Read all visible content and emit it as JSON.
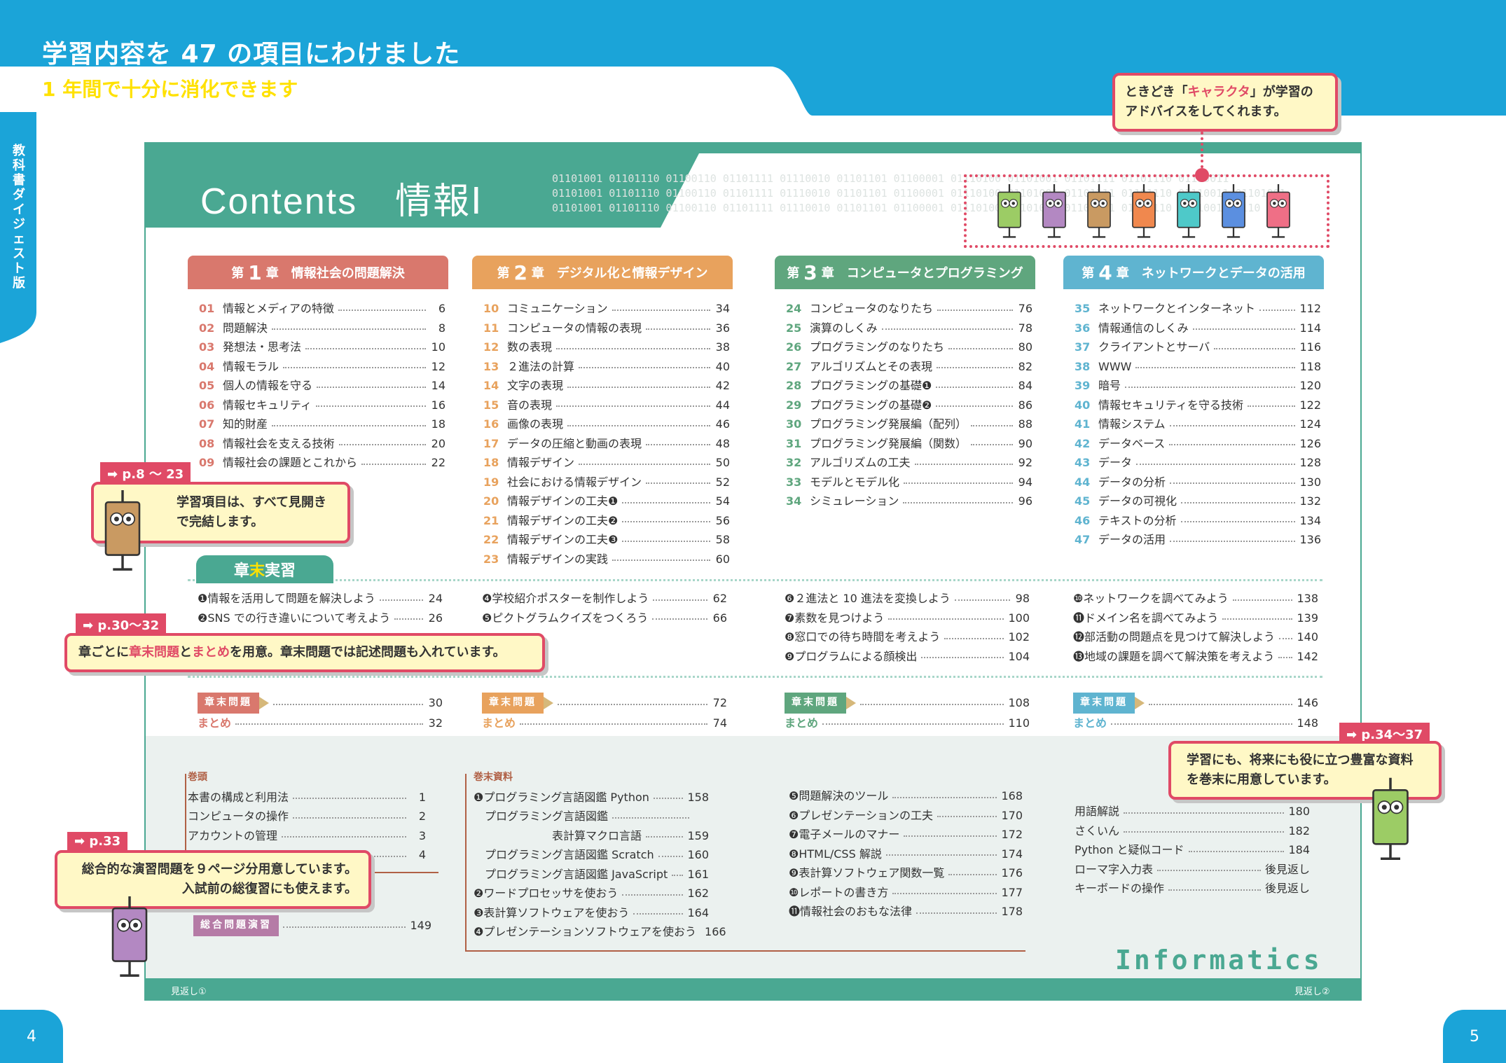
{
  "header": {
    "title": "学習内容を 47 の項目にわけました",
    "subtitle": "1 年間で十分に消化できます",
    "side_label": "教科書ダイジェスト版"
  },
  "pages": {
    "left": "4",
    "right": "5"
  },
  "panel": {
    "title": "Contents　情報Ⅰ",
    "binary": [
      "01101001 01101110 01100110 01101111 01110010 01101101 01100001 01110100 01101001 01101111 01101110 01110011",
      "01101001 01101110 01100110 01101111 01110010 01101101 01100001 01110100 01101001 01101111 01101110 01110011 01101001",
      "01101001 01101110 01100110 01101111 01110010 01101101 01100001 01110100 01101001 01101111 01101110 01110011 0110"
    ],
    "footer_left": "見返し①",
    "footer_right": "見返し②",
    "brand": "Informatics"
  },
  "colors": {
    "blue": "#1ba4d8",
    "green": "#4aa892",
    "ch1": "#d9786d",
    "ch2": "#e8a25d",
    "ch3": "#5fa67e",
    "ch4": "#5fb4d0",
    "accent": "#e04a66"
  },
  "chapters": [
    {
      "pre": "第",
      "num": "1",
      "post": "章　情報社会の問題解決",
      "items": [
        {
          "n": "01",
          "t": "情報とメディアの特徴",
          "p": "6"
        },
        {
          "n": "02",
          "t": "問題解決",
          "p": "8"
        },
        {
          "n": "03",
          "t": "発想法・思考法",
          "p": "10"
        },
        {
          "n": "04",
          "t": "情報モラル",
          "p": "12"
        },
        {
          "n": "05",
          "t": "個人の情報を守る",
          "p": "14"
        },
        {
          "n": "06",
          "t": "情報セキュリティ",
          "p": "16"
        },
        {
          "n": "07",
          "t": "知的財産",
          "p": "18"
        },
        {
          "n": "08",
          "t": "情報社会を支える技術",
          "p": "20"
        },
        {
          "n": "09",
          "t": "情報社会の課題とこれから",
          "p": "22"
        }
      ]
    },
    {
      "pre": "第",
      "num": "2",
      "post": "章　デジタル化と情報デザイン",
      "items": [
        {
          "n": "10",
          "t": "コミュニケーション",
          "p": "34"
        },
        {
          "n": "11",
          "t": "コンピュータの情報の表現",
          "p": "36"
        },
        {
          "n": "12",
          "t": "数の表現",
          "p": "38"
        },
        {
          "n": "13",
          "t": "２進法の計算",
          "p": "40"
        },
        {
          "n": "14",
          "t": "文字の表現",
          "p": "42"
        },
        {
          "n": "15",
          "t": "音の表現",
          "p": "44"
        },
        {
          "n": "16",
          "t": "画像の表現",
          "p": "46"
        },
        {
          "n": "17",
          "t": "データの圧縮と動画の表現",
          "p": "48"
        },
        {
          "n": "18",
          "t": "情報デザイン",
          "p": "50"
        },
        {
          "n": "19",
          "t": "社会における情報デザイン",
          "p": "52"
        },
        {
          "n": "20",
          "t": "情報デザインの工夫❶",
          "p": "54"
        },
        {
          "n": "21",
          "t": "情報デザインの工夫❷",
          "p": "56"
        },
        {
          "n": "22",
          "t": "情報デザインの工夫❸",
          "p": "58"
        },
        {
          "n": "23",
          "t": "情報デザインの実践",
          "p": "60"
        }
      ]
    },
    {
      "pre": "第",
      "num": "3",
      "post": "章　コンピュータとプログラミング",
      "items": [
        {
          "n": "24",
          "t": "コンピュータのなりたち",
          "p": "76"
        },
        {
          "n": "25",
          "t": "演算のしくみ",
          "p": "78"
        },
        {
          "n": "26",
          "t": "プログラミングのなりたち",
          "p": "80"
        },
        {
          "n": "27",
          "t": "アルゴリズムとその表現",
          "p": "82"
        },
        {
          "n": "28",
          "t": "プログラミングの基礎❶",
          "p": "84"
        },
        {
          "n": "29",
          "t": "プログラミングの基礎❷",
          "p": "86"
        },
        {
          "n": "30",
          "t": "プログラミング発展編（配列）",
          "p": "88"
        },
        {
          "n": "31",
          "t": "プログラミング発展編（関数）",
          "p": "90"
        },
        {
          "n": "32",
          "t": "アルゴリズムの工夫",
          "p": "92"
        },
        {
          "n": "33",
          "t": "モデルとモデル化",
          "p": "94"
        },
        {
          "n": "34",
          "t": "シミュレーション",
          "p": "96"
        }
      ]
    },
    {
      "pre": "第",
      "num": "4",
      "post": "章　ネットワークとデータの活用",
      "items": [
        {
          "n": "35",
          "t": "ネットワークとインターネット",
          "p": "112"
        },
        {
          "n": "36",
          "t": "情報通信のしくみ",
          "p": "114"
        },
        {
          "n": "37",
          "t": "クライアントとサーバ",
          "p": "116"
        },
        {
          "n": "38",
          "t": "WWW",
          "p": "118"
        },
        {
          "n": "39",
          "t": "暗号",
          "p": "120"
        },
        {
          "n": "40",
          "t": "情報セキュリティを守る技術",
          "p": "122"
        },
        {
          "n": "41",
          "t": "情報システム",
          "p": "124"
        },
        {
          "n": "42",
          "t": "データベース",
          "p": "126"
        },
        {
          "n": "43",
          "t": "データ",
          "p": "128"
        },
        {
          "n": "44",
          "t": "データの分析",
          "p": "130"
        },
        {
          "n": "45",
          "t": "データの可視化",
          "p": "132"
        },
        {
          "n": "46",
          "t": "テキストの分析",
          "p": "134"
        },
        {
          "n": "47",
          "t": "データの活用",
          "p": "136"
        }
      ]
    }
  ],
  "practice": {
    "label_a": "章",
    "label_b": "末",
    "label_c": "実習",
    "cols": [
      [
        {
          "t": "❶情報を活用して問題を解決しよう",
          "p": "24"
        },
        {
          "t": "❷SNS での行き違いについて考えよう",
          "p": "26"
        }
      ],
      [
        {
          "t": "❹学校紹介ポスターを制作しよう",
          "p": "62"
        },
        {
          "t": "❺ピクトグラムクイズをつくろう",
          "p": "66"
        }
      ],
      [
        {
          "t": "❻２進法と 10 進法を変換しよう",
          "p": "98"
        },
        {
          "t": "❼素数を見つけよう",
          "p": "100"
        },
        {
          "t": "❽窓口での待ち時間を考えよう",
          "p": "102"
        },
        {
          "t": "❾プログラムによる顔検出",
          "p": "104"
        }
      ],
      [
        {
          "t": "❿ネットワークを調べてみよう",
          "p": "138"
        },
        {
          "t": "⓫ドメイン名を調べてみよう",
          "p": "139"
        },
        {
          "t": "⓬部活動の問題点を見つけて解決しよう",
          "p": "140"
        },
        {
          "t": "⓭地域の課題を調べて解決策を考えよう",
          "p": "142"
        }
      ]
    ]
  },
  "endq": {
    "badge": "章末問題",
    "summary": "まとめ",
    "pages": [
      [
        "30",
        "32"
      ],
      [
        "72",
        "74"
      ],
      [
        "108",
        "110"
      ],
      [
        "146",
        "148"
      ]
    ]
  },
  "front": {
    "title": "巻頭",
    "items": [
      {
        "t": "本書の構成と利用法",
        "p": "1"
      },
      {
        "t": "コンピュータの操作",
        "p": "2"
      },
      {
        "t": "アカウントの管理",
        "p": "3"
      },
      {
        "t": "",
        "p": "4"
      }
    ],
    "exam": "総合問題演習",
    "exam_p": "149"
  },
  "appendix": {
    "title": "巻末資料",
    "col1": [
      {
        "t": "❶プログラミング言語図鑑 Python",
        "p": "158"
      },
      {
        "t": "　プログラミング言語図鑑",
        "p": ""
      },
      {
        "t": "　　　　　　　表計算マクロ言語",
        "p": "159"
      },
      {
        "t": "　プログラミング言語図鑑 Scratch",
        "p": "160"
      },
      {
        "t": "　プログラミング言語図鑑 JavaScript",
        "p": "161"
      },
      {
        "t": "❷ワードプロセッサを使おう",
        "p": "162"
      },
      {
        "t": "❸表計算ソフトウェアを使おう",
        "p": "164"
      },
      {
        "t": "❹プレゼンテーションソフトウェアを使おう",
        "p": "166"
      }
    ],
    "col2": [
      {
        "t": "❺問題解決のツール",
        "p": "168"
      },
      {
        "t": "❻プレゼンテーションの工夫",
        "p": "170"
      },
      {
        "t": "❼電子メールのマナー",
        "p": "172"
      },
      {
        "t": "❽HTML/CSS 解説",
        "p": "174"
      },
      {
        "t": "❾表計算ソフトウェア関数一覧",
        "p": "176"
      },
      {
        "t": "❿レポートの書き方",
        "p": "177"
      },
      {
        "t": "⓫情報社会のおもな法律",
        "p": "178"
      }
    ],
    "col3": [
      {
        "t": "用語解説",
        "p": "180"
      },
      {
        "t": "さくいん",
        "p": "182"
      },
      {
        "t": "Python と疑似コード",
        "p": "184"
      },
      {
        "t": "ローマ字入力表",
        "p": "後見返し"
      },
      {
        "t": "キーボードの操作",
        "p": "後見返し"
      }
    ]
  },
  "callouts": {
    "c1": {
      "a": "ときどき「",
      "b": "キャラクタ",
      "c": "」が学習の",
      "d": "アドバイスをしてくれます。"
    },
    "c2": {
      "tag": "➡ p.8 ～ 23",
      "a": "学習項目は、すべて見開き",
      "b": "で完結します。"
    },
    "c3": {
      "tag": "➡ p.30〜32",
      "a": "章ごとに",
      "b": "章末問題",
      "c": "と",
      "d": "まとめ",
      "e": "を用意。章末問題では記述問題も入れています。"
    },
    "c4": {
      "tag": "➡ p.34〜37",
      "a": "学習にも、将来にも役に立つ豊富な資料",
      "b": "を巻末に用意しています。"
    },
    "c5": {
      "tag": "➡ p.33",
      "a": "総合的な演習問題を９ページ分用意しています。",
      "b": "入試前の総復習にも使えます。"
    }
  }
}
